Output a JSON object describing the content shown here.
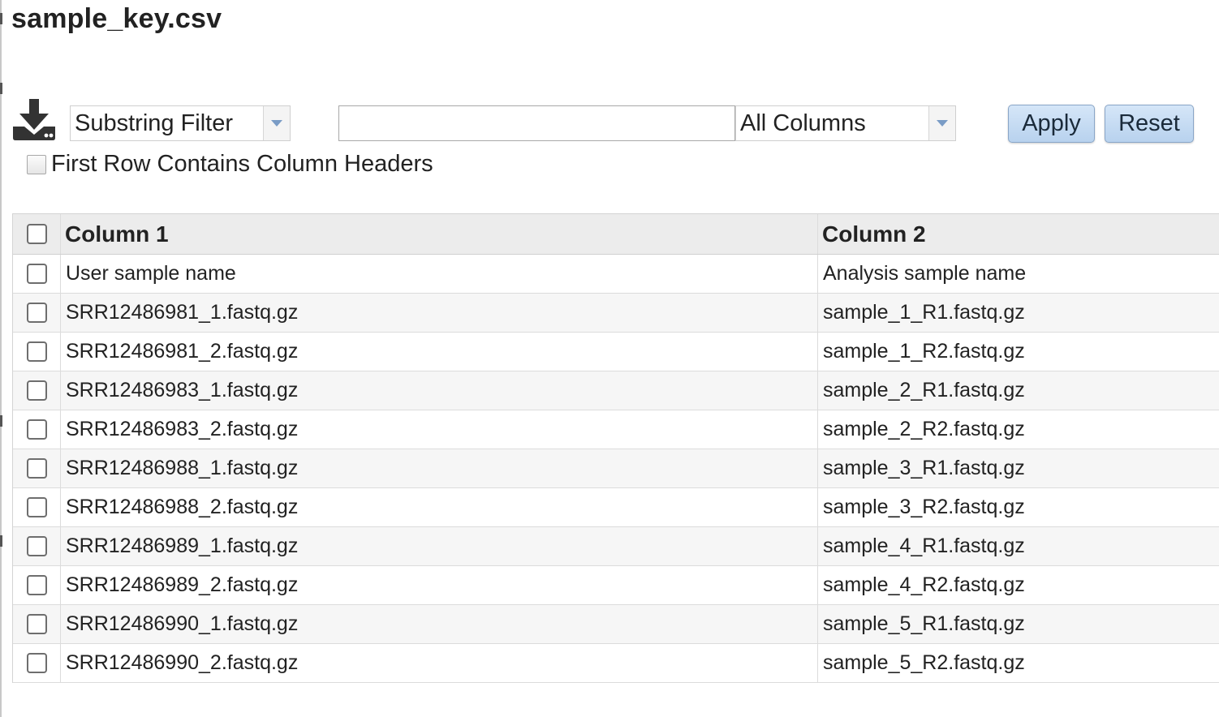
{
  "page": {
    "title": "sample_key.csv"
  },
  "toolbar": {
    "download_icon": "download-icon",
    "filter_type": {
      "selected": "Substring Filter"
    },
    "filter_text": {
      "value": "",
      "placeholder": ""
    },
    "column_select": {
      "selected": "All Columns"
    },
    "apply_label": "Apply",
    "reset_label": "Reset"
  },
  "options": {
    "first_row_headers": {
      "label": "First Row Contains Column Headers",
      "checked": false
    }
  },
  "table": {
    "columns": [
      "Column 1",
      "Column 2"
    ],
    "rows": [
      [
        "User sample name",
        "Analysis sample name"
      ],
      [
        "SRR12486981_1.fastq.gz",
        "sample_1_R1.fastq.gz"
      ],
      [
        "SRR12486981_2.fastq.gz",
        "sample_1_R2.fastq.gz"
      ],
      [
        "SRR12486983_1.fastq.gz",
        "sample_2_R1.fastq.gz"
      ],
      [
        "SRR12486983_2.fastq.gz",
        "sample_2_R2.fastq.gz"
      ],
      [
        "SRR12486988_1.fastq.gz",
        "sample_3_R1.fastq.gz"
      ],
      [
        "SRR12486988_2.fastq.gz",
        "sample_3_R2.fastq.gz"
      ],
      [
        "SRR12486989_1.fastq.gz",
        "sample_4_R1.fastq.gz"
      ],
      [
        "SRR12486989_2.fastq.gz",
        "sample_4_R2.fastq.gz"
      ],
      [
        "SRR12486990_1.fastq.gz",
        "sample_5_R1.fastq.gz"
      ],
      [
        "SRR12486990_2.fastq.gz",
        "sample_5_R2.fastq.gz"
      ]
    ]
  },
  "colors": {
    "button_bg": "#c4dbf3",
    "header_bg": "#ececec",
    "row_alt_bg": "#f6f6f6",
    "icon": "#333333"
  }
}
